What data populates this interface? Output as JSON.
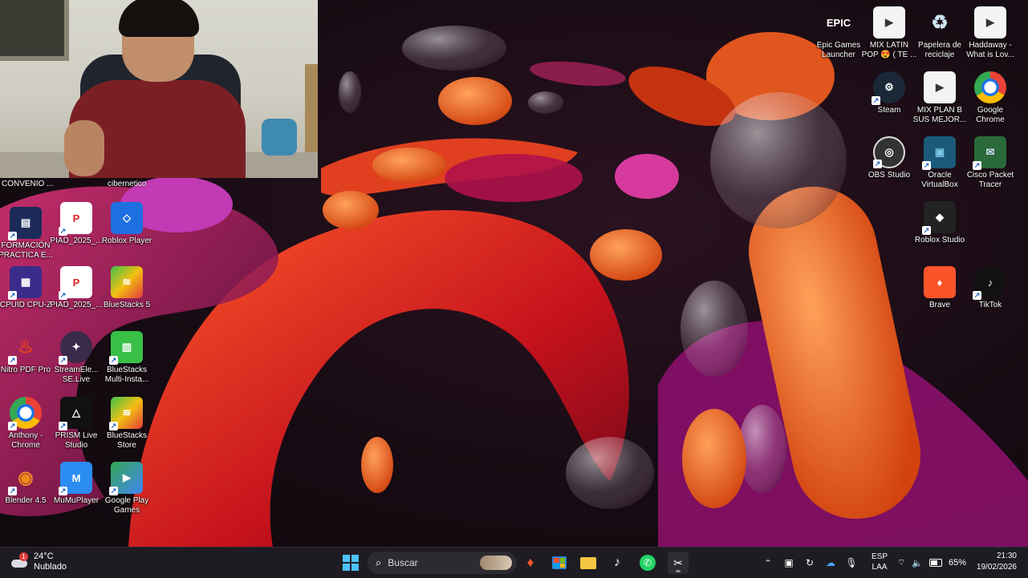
{
  "webcam_labels": {
    "left": "CONVENIO ...",
    "right": "cibernetico"
  },
  "desktop_left": [
    {
      "label": "FORMACIÓN PRACTICA E...",
      "icon": "pptx-file-icon"
    },
    {
      "label": "PIAD_2025_...",
      "icon": "pdf-file-icon"
    },
    {
      "label": "Roblox Player",
      "icon": "roblox-icon"
    },
    {
      "label": "CPUID CPU-Z",
      "icon": "cpuz-icon"
    },
    {
      "label": "PIAD_2025_...",
      "icon": "pdf-file-icon"
    },
    {
      "label": "BlueStacks 5",
      "icon": "bluestacks-icon"
    },
    {
      "label": "Nitro PDF Pro",
      "icon": "nitro-pdf-icon"
    },
    {
      "label": "StreamEle... SE.Live",
      "icon": "streamelements-icon"
    },
    {
      "label": "BlueStacks Multi-Insta...",
      "icon": "bluestacks-multi-icon"
    },
    {
      "label": "Anthony - Chrome",
      "icon": "chrome-profile-icon"
    },
    {
      "label": "PRISM Live Studio",
      "icon": "prism-icon"
    },
    {
      "label": "BlueStacks Store",
      "icon": "bluestacks-store-icon"
    },
    {
      "label": "Blender 4.5",
      "icon": "blender-icon"
    },
    {
      "label": "MuMuPlayer",
      "icon": "mumu-icon"
    },
    {
      "label": "Google Play Games",
      "icon": "google-play-games-icon"
    }
  ],
  "desktop_right": [
    {
      "label": "Epic Games Launcher",
      "icon": "epic-games-icon",
      "glyph": "EPIC"
    },
    {
      "label": "MIX LATIN POP 😍 ( TE ...",
      "icon": "video-file-icon"
    },
    {
      "label": "Papelera de reciclaje",
      "icon": "recycle-bin-icon"
    },
    {
      "label": "Haddaway - What is Lov...",
      "icon": "video-file-icon"
    },
    {
      "label": "Steam",
      "icon": "steam-icon"
    },
    {
      "label": "MIX PLAN B SUS MEJOR...",
      "icon": "video-file-icon"
    },
    {
      "label": "Google Chrome",
      "icon": "chrome-icon"
    },
    {
      "label": "OBS Studio",
      "icon": "obs-icon"
    },
    {
      "label": "Oracle VirtualBox",
      "icon": "virtualbox-icon"
    },
    {
      "label": "Cisco Packet Tracer",
      "icon": "packet-tracer-icon"
    },
    {
      "label": "Roblox Studio",
      "icon": "roblox-studio-icon"
    },
    {
      "label": "Brave",
      "icon": "brave-icon"
    },
    {
      "label": "TikTok",
      "icon": "tiktok-icon"
    }
  ],
  "taskbar": {
    "weather": {
      "temp": "24°C",
      "condition": "Nublado",
      "alert": "1"
    },
    "search_placeholder": "Buscar",
    "apps": [
      "start-icon",
      "brave-icon",
      "microsoft-store-icon",
      "file-explorer-icon",
      "tiktok-icon",
      "whatsapp-icon",
      "snipping-tool-icon"
    ],
    "lang": {
      "code": "ESP",
      "sub": "LAA"
    },
    "battery": "65%",
    "time": "21:30",
    "date": "19/02/2026"
  },
  "colors": {
    "accent": "#0078d4",
    "taskbar": "#1e1c22"
  }
}
